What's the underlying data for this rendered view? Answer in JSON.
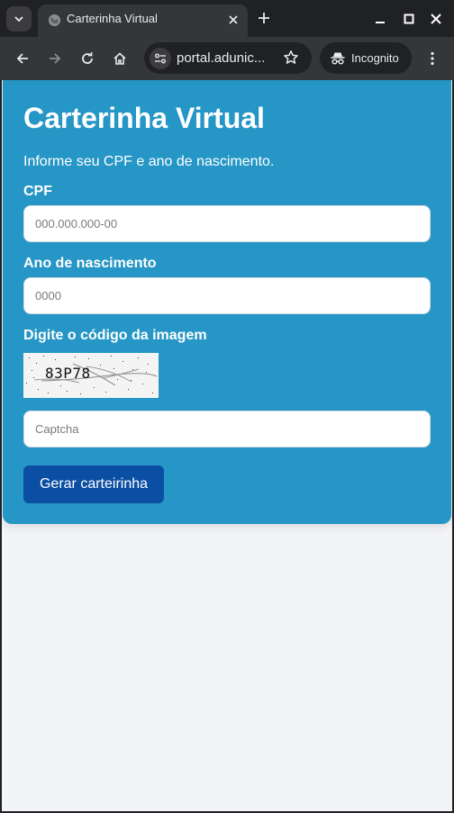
{
  "browser": {
    "tab": {
      "title": "Carterinha Virtual",
      "favicon": "globe-icon"
    },
    "url": "portal.adunic...",
    "incognito_label": "Incognito",
    "icons": [
      "tab-search-icon",
      "globe-icon",
      "close-icon",
      "plus-icon",
      "minimize-icon",
      "maximize-icon",
      "window-close-icon",
      "back-arrow-icon",
      "forward-arrow-icon",
      "reload-icon",
      "home-icon",
      "site-info-icon",
      "star-icon",
      "incognito-icon",
      "kebab-menu-icon"
    ]
  },
  "page": {
    "title": "Carterinha Virtual",
    "subtitle": "Informe seu CPF e ano de nascimento.",
    "cpf": {
      "label": "CPF",
      "placeholder": "000.000.000-00",
      "value": ""
    },
    "birth_year": {
      "label": "Ano de nascimento",
      "placeholder": "0000",
      "value": ""
    },
    "captcha": {
      "label": "Digite o código da imagem",
      "image_code": "83P78",
      "placeholder": "Captcha",
      "value": ""
    },
    "submit_label": "Gerar carteirinha"
  },
  "colors": {
    "card": "#2596c5",
    "button": "#0b4fa4",
    "page_background": "#f3f4f8",
    "browser_frame": "#202124",
    "toolbar": "#35363a"
  }
}
